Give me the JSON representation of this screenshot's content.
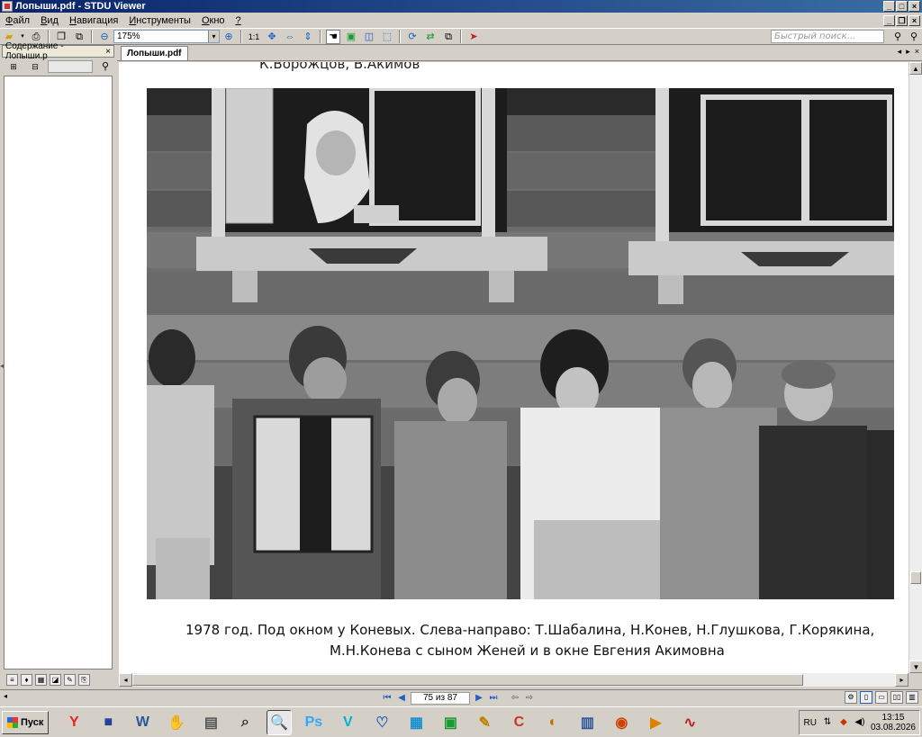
{
  "window": {
    "title": "Лопыши.pdf - STDU Viewer"
  },
  "menu": {
    "items": [
      {
        "ul": "Ф",
        "rest": "айл"
      },
      {
        "ul": "В",
        "rest": "ид"
      },
      {
        "ul": "Н",
        "rest": "авигация"
      },
      {
        "ul": "И",
        "rest": "нструменты"
      },
      {
        "ul": "О",
        "rest": "кно"
      },
      {
        "ul": "?",
        "rest": ""
      }
    ]
  },
  "toolbar": {
    "zoom_value": "175%",
    "ratio_label": "1:1",
    "search_placeholder": "Быстрый поиск..."
  },
  "sidebar": {
    "tab_label": "Содержание - Лопыши.р",
    "close_label": "×"
  },
  "document": {
    "tab_label": "Лопыши.pdf",
    "top_cut_text": "К.Ворожцов, В.Акимов",
    "caption_line1": "1978 год. Под окном у Коневых. Слева-направо: Т.Шабалина, Н.Конев, Н.Глушкова, Г.Корякина,",
    "caption_line2": "М.Н.Конева с сыном Женей и в окне Евгения Акимовна"
  },
  "navigation": {
    "page_indicator": "75 из 87"
  },
  "taskbar": {
    "start_label": "Пуск",
    "lang": "RU",
    "time": "13:15",
    "date": "03.08.2026",
    "apps": [
      {
        "name": "yandex-browser-icon",
        "glyph": "Y",
        "color": "#e22"
      },
      {
        "name": "save-disk-icon",
        "glyph": "■",
        "color": "#2a3f9a"
      },
      {
        "name": "word-document-icon",
        "glyph": "W",
        "color": "#2b579a"
      },
      {
        "name": "hand-tool-icon",
        "glyph": "✋",
        "color": "#b06a20"
      },
      {
        "name": "scanner-icon",
        "glyph": "▤",
        "color": "#555"
      },
      {
        "name": "search-app-icon",
        "glyph": "⌕",
        "color": "#333"
      },
      {
        "name": "magnifier-viewer-icon",
        "glyph": "🔍",
        "color": "#1f5fbf"
      },
      {
        "name": "photoshop-icon",
        "glyph": "Ps",
        "color": "#31a8ff"
      },
      {
        "name": "vector-app-icon",
        "glyph": "V",
        "color": "#00b4d8"
      },
      {
        "name": "pocket-icon",
        "glyph": "♡",
        "color": "#1f5fbf"
      },
      {
        "name": "film-editor-icon",
        "glyph": "▦",
        "color": "#1a8fd0"
      },
      {
        "name": "calculator-icon",
        "glyph": "▣",
        "color": "#1a9a30"
      },
      {
        "name": "brush-icon",
        "glyph": "✎",
        "color": "#c08000"
      },
      {
        "name": "ccleaner-icon",
        "glyph": "C",
        "color": "#d03020"
      },
      {
        "name": "palette-icon",
        "glyph": "◐",
        "color": "#c07000"
      },
      {
        "name": "document-viewer-icon",
        "glyph": "▥",
        "color": "#2b579a"
      },
      {
        "name": "eye-app-icon",
        "glyph": "◉",
        "color": "#d04000"
      },
      {
        "name": "media-player-icon",
        "glyph": "▶",
        "color": "#e08000"
      },
      {
        "name": "audio-editor-icon",
        "glyph": "∿",
        "color": "#c02020"
      }
    ]
  }
}
